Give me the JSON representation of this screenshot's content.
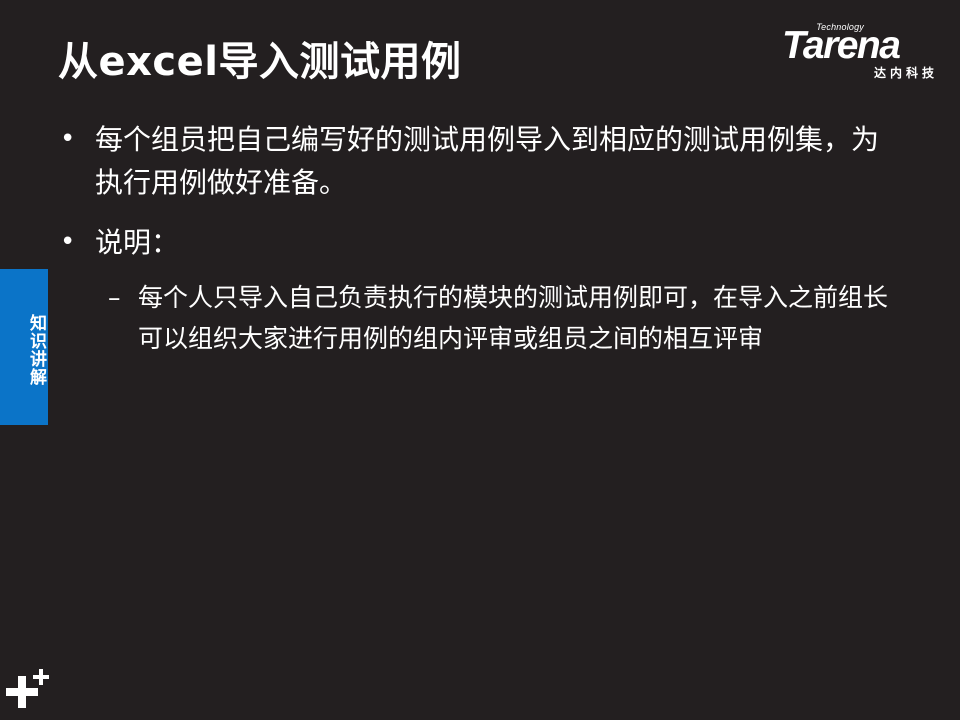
{
  "slide": {
    "title": "从excel导入测试用例",
    "bullets": [
      {
        "marker": "•",
        "text": "每个组员把自己编写好的测试用例导入到相应的测试用例集，为执行用例做好准备。"
      },
      {
        "marker": "•",
        "text": "说明："
      }
    ],
    "sub_bullets": [
      {
        "marker": "–",
        "text": "每个人只导入自己负责执行的模块的测试用例即可，在导入之前组长可以组织大家进行用例的组内评审或组员之间的相互评审"
      }
    ]
  },
  "logo": {
    "tagline": "Technology",
    "wordmark": "Tarena",
    "chinese_name": "达内科技"
  },
  "side_tab": {
    "label": "知识讲解"
  },
  "decoration": {
    "plus_icon": "plus-icon"
  },
  "colors": {
    "background": "#231f20",
    "text": "#ffffff",
    "side_tab": "#0b74c8"
  }
}
